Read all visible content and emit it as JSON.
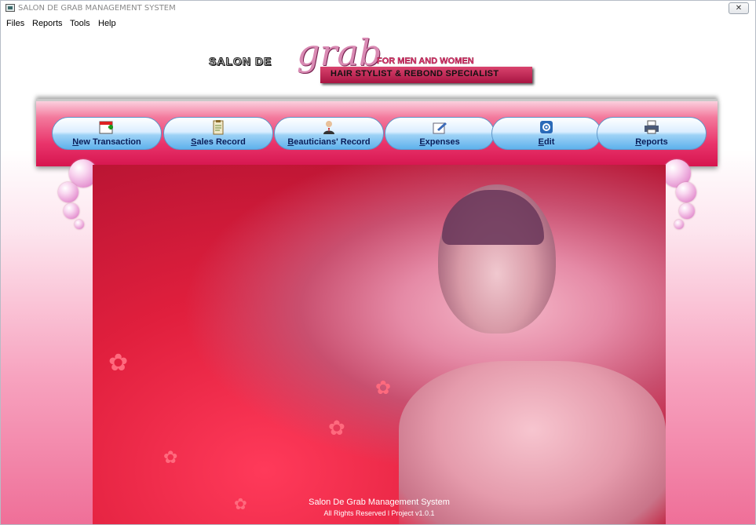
{
  "window": {
    "title": "SALON DE GRAB MANAGEMENT SYSTEM",
    "close_label": "✕"
  },
  "menu": [
    "Files",
    "Reports",
    "Tools",
    "Help"
  ],
  "logo": {
    "salon_de": "SALON DE",
    "grab": "grab",
    "for_men_women": "FOR MEN AND WOMEN",
    "tagline": "HAIR STYLIST & REBOND SPECIALIST"
  },
  "toolbar": {
    "buttons": [
      {
        "key": "N",
        "rest": "ew Transaction",
        "icon": "calendar-add-icon"
      },
      {
        "key": "S",
        "rest": "ales Record",
        "icon": "clipboard-icon"
      },
      {
        "key": "B",
        "rest": "eauticians' Record",
        "icon": "person-icon"
      },
      {
        "key": "E",
        "rest": "xpenses",
        "icon": "pen-paper-icon"
      },
      {
        "key": "E",
        "rest": "dit",
        "icon": "gear-edit-icon"
      },
      {
        "key": "R",
        "rest": "eports",
        "icon": "printer-icon"
      }
    ]
  },
  "footer": {
    "line1": "Salon De Grab Management System",
    "line2": "All Rights Reserved l Project v1.0.1"
  },
  "colors": {
    "accent": "#e9346b",
    "button_blue": "#5eb1ec",
    "label_text": "#0a1e5a"
  }
}
